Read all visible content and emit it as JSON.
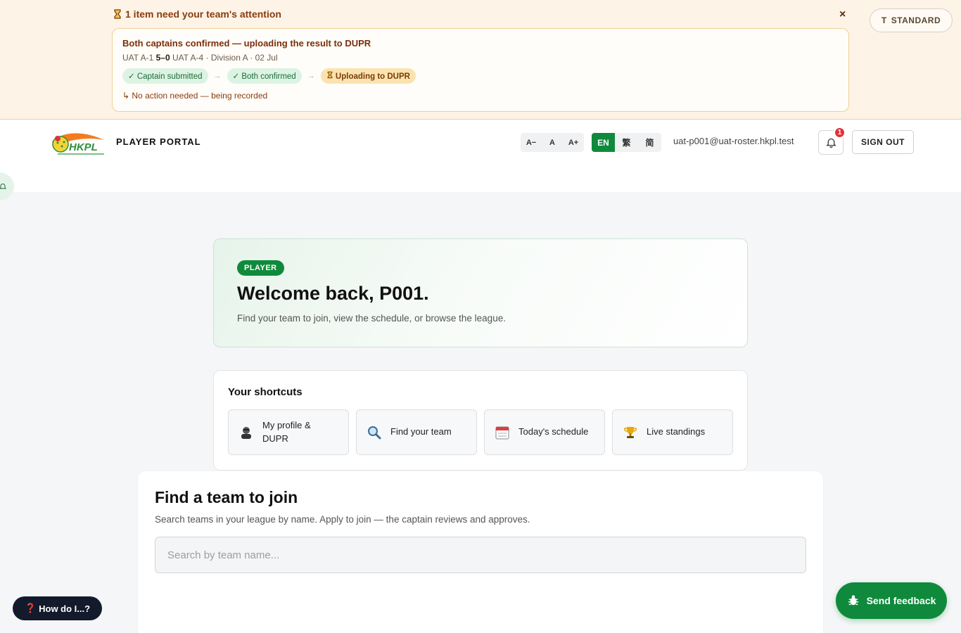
{
  "banner": {
    "title": "1 item need your team's attention",
    "close_label": "×",
    "standard_label": "STANDARD",
    "card": {
      "headline": "Both captains confirmed — uploading the result to DUPR",
      "team_home": "UAT A-1",
      "score": "5–0",
      "team_away": "UAT A-4",
      "meta_suffix": "· Division A · 02 Jul",
      "steps": [
        {
          "label": "✓ Captain submitted",
          "state": "done"
        },
        {
          "label": "✓ Both confirmed",
          "state": "done"
        },
        {
          "label": "Uploading to DUPR",
          "state": "active"
        }
      ],
      "arrow": "→",
      "note": "↳ No action needed — being recorded"
    }
  },
  "header": {
    "logo_text": "HKPL",
    "portal_label": "PLAYER PORTAL",
    "font_sizes": [
      "A−",
      "A",
      "A+"
    ],
    "languages": [
      {
        "label": "EN",
        "active": true
      },
      {
        "label": "繁",
        "active": false
      },
      {
        "label": "简",
        "active": false
      }
    ],
    "user_email": "uat-p001@uat-roster.hkpl.test",
    "notification_count": "1",
    "sign_out_label": "SIGN OUT"
  },
  "welcome": {
    "role": "PLAYER",
    "heading": "Welcome back, P001.",
    "subtext": "Find your team to join, view the schedule, or browse the league."
  },
  "shortcuts": {
    "title": "Your shortcuts",
    "items": [
      {
        "label": "My profile & DUPR",
        "icon": "person-icon"
      },
      {
        "label": "Find your team",
        "icon": "magnifier-icon"
      },
      {
        "label": "Today's schedule",
        "icon": "calendar-icon"
      },
      {
        "label": "Live standings",
        "icon": "trophy-icon"
      }
    ]
  },
  "find_team": {
    "title": "Find a team to join",
    "subtitle": "Search teams in your league by name. Apply to join — the captain reviews and approves.",
    "search_placeholder": "Search by team name..."
  },
  "floating": {
    "help_label": "How do I...?",
    "feedback_label": "Send feedback"
  },
  "colors": {
    "brand_green": "#0f8a3c",
    "banner_bg": "#fdf3e6",
    "alert_red": "#e0323b"
  }
}
